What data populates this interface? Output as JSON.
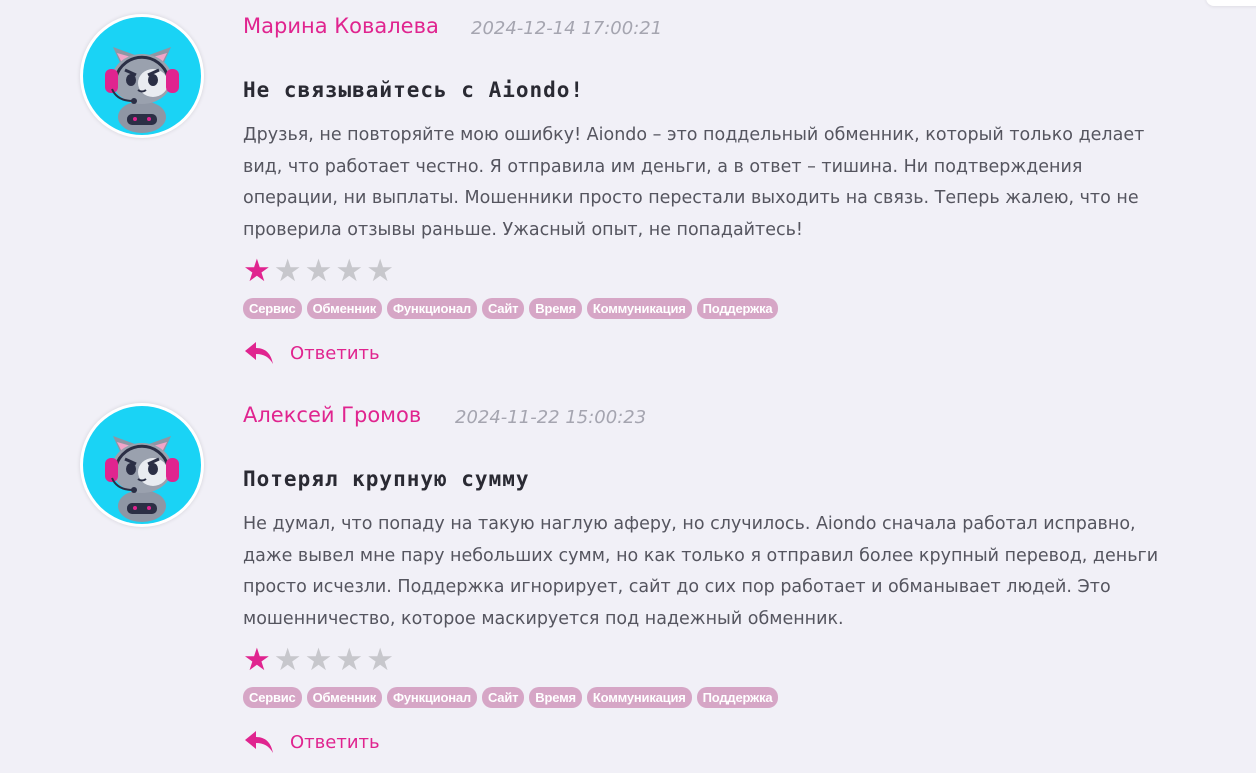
{
  "reviews": [
    {
      "author": "Марина Ковалева",
      "date": "2024-12-14 17:00:21",
      "title": "Не связывайтесь с Aiondo!",
      "text": "Друзья, не повторяйте мою ошибку! Aiondo – это поддельный обменник, который только делает вид, что работает честно. Я отправила им деньги, а в ответ – тишина. Ни подтверждения операции, ни выплаты. Мошенники просто перестали выходить на связь. Теперь жалею, что не проверила отзывы раньше. Ужасный опыт, не попадайтесь!",
      "rating": 1,
      "max_rating": 5,
      "tags": [
        "Сервис",
        "Обменник",
        "Функционал",
        "Сайт",
        "Время",
        "Коммуникация",
        "Поддержка"
      ],
      "reply_label": "Ответить",
      "avatar_icon": "cat-gamer-avatar-icon"
    },
    {
      "author": "Алексей Громов",
      "date": "2024-11-22 15:00:23",
      "title": "Потерял крупную сумму",
      "text": "Не думал, что попаду на такую наглую аферу, но случилось. Aiondo сначала работал исправно, даже вывел мне пару небольших сумм, но как только я отправил более крупный перевод, деньги просто исчезли. Поддержка игнорирует, сайт до сих пор работает и обманывает людей. Это мошенничество, которое маскируется под надежный обменник.",
      "rating": 1,
      "max_rating": 5,
      "tags": [
        "Сервис",
        "Обменник",
        "Функционал",
        "Сайт",
        "Время",
        "Коммуникация",
        "Поддержка"
      ],
      "reply_label": "Ответить",
      "avatar_icon": "cat-gamer-avatar-icon"
    }
  ],
  "colors": {
    "accent": "#e0248f",
    "tag_bg": "#d6a6c6",
    "star_off": "#c7c7cc",
    "background": "#f1f0f7"
  }
}
